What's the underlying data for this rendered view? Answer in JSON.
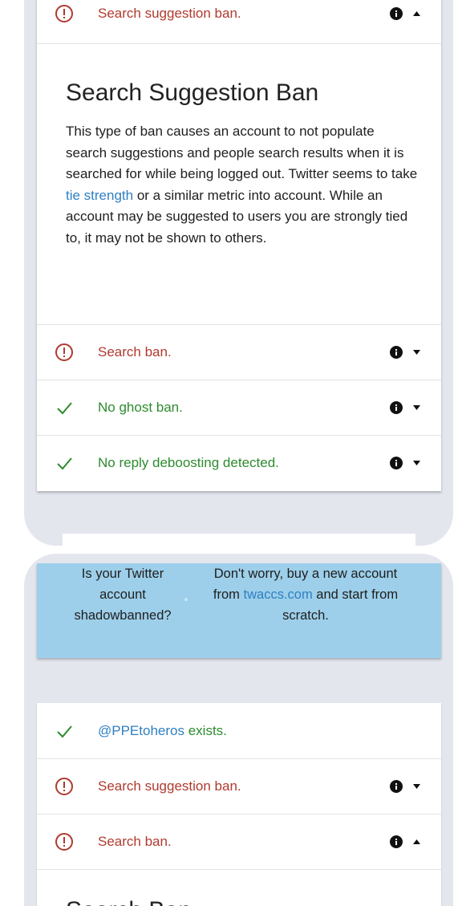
{
  "results_top": [
    {
      "status": "error",
      "text": "Search suggestion ban.",
      "has_info": true,
      "expanded": true
    }
  ],
  "detail": {
    "title": "Search Suggestion Ban",
    "text_before_link": "This type of ban causes an account to not populate search suggestions and people search results when it is searched for while being logged out. Twitter seems to take ",
    "link": "tie strength",
    "text_after_link": " or a similar metric into account. While an account may be suggested to users you are strongly tied to, it may not be shown to others."
  },
  "results_mid": [
    {
      "status": "error",
      "text": "Search ban.",
      "has_info": true,
      "expanded": false
    },
    {
      "status": "ok",
      "text": "No ghost ban.",
      "has_info": true,
      "expanded": false
    },
    {
      "status": "ok",
      "text": "No reply deboosting detected.",
      "has_info": true,
      "expanded": false
    }
  ],
  "banner": {
    "left_line1": "Is your Twitter",
    "left_line2": "account",
    "left_line3": "shadowbanned?",
    "right_line1": "Don't worry, buy a new account",
    "right_before_link": "from ",
    "right_link": "twaccs.com",
    "right_after_link": " and start from",
    "right_line3": "scratch."
  },
  "results_bottom": {
    "exists": {
      "status": "ok",
      "handle": "@PPEtoheros",
      "suffix": " exists."
    },
    "rows": [
      {
        "status": "error",
        "text": "Search suggestion ban.",
        "has_info": true,
        "expanded": false
      },
      {
        "status": "error",
        "text": "Search ban.",
        "has_info": true,
        "expanded": true
      }
    ],
    "detail_title_partial": "Search Ban"
  },
  "colors": {
    "error": "#b03a2e",
    "ok": "#2e8b2e",
    "link": "#2f7fc1",
    "banner_bg": "#9dcfea",
    "panel_bg": "#e4e6ee"
  },
  "icons": {
    "error": "exclamation-circle-icon",
    "ok": "checkmark-icon",
    "info": "info-circle-icon",
    "caret_down": "caret-down-icon",
    "caret_up": "caret-up-icon"
  }
}
